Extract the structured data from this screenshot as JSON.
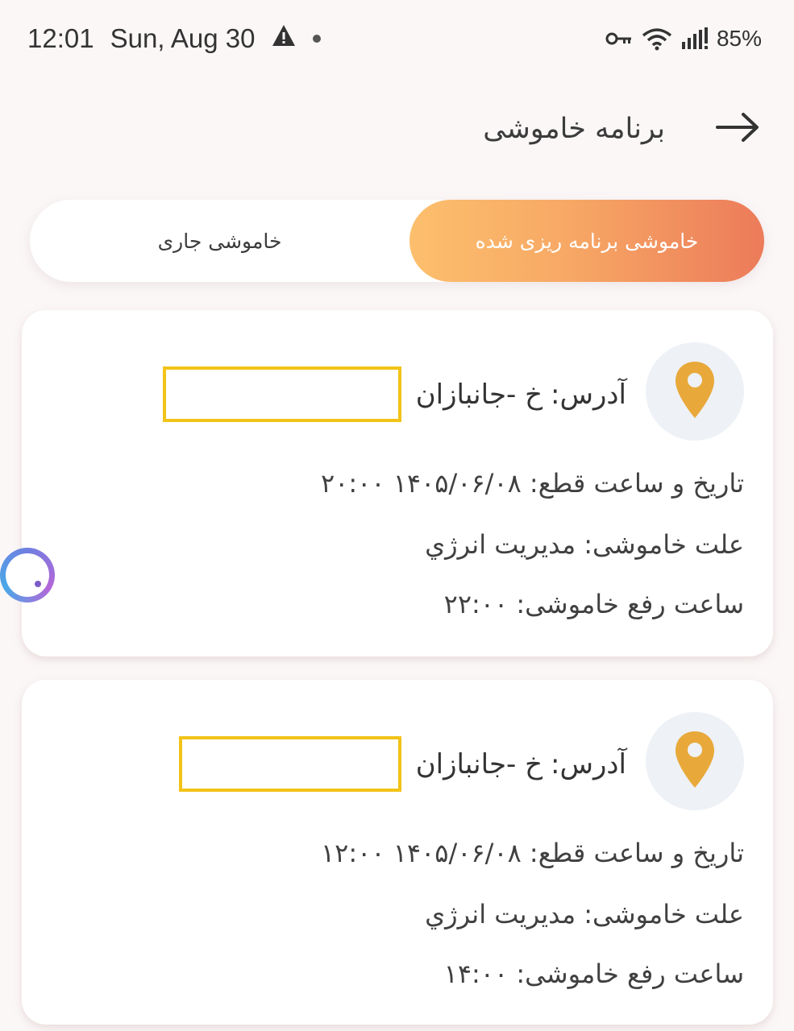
{
  "status_bar": {
    "time": "12:01",
    "date": "Sun, Aug 30",
    "battery": "85%",
    "icons": [
      "alert-icon",
      "notification-dot-icon",
      "vpn-key-icon",
      "wifi-icon",
      "signal-icon"
    ]
  },
  "header": {
    "title": "برنامه خاموشی",
    "back_icon": "arrow-right-icon"
  },
  "tabs": [
    {
      "label": "خاموشی برنامه ریزی شده",
      "active": true
    },
    {
      "label": "خاموشی جاری",
      "active": false
    }
  ],
  "cards": [
    {
      "address_label": "آدرس:",
      "address_value": "خ -جانبازان",
      "cut_time": "تاریخ و ساعت قطع: ۱۴۰۵/۰۶/۰۸ ۲۰:۰۰",
      "reason": "علت خاموشی: مديريت انرژي",
      "restore_time": "ساعت رفع خاموشی: ۲۲:۰۰"
    },
    {
      "address_label": "آدرس:",
      "address_value": "خ -جانبازان",
      "cut_time": "تاریخ و ساعت قطع: ۱۴۰۵/۰۶/۰۸ ۱۲:۰۰",
      "reason": "علت خاموشی: مديريت انرژي",
      "restore_time": "ساعت رفع خاموشی: ۱۴:۰۰"
    }
  ],
  "colors": {
    "accent_start": "#fcbf6d",
    "accent_end": "#ec7b5a",
    "pin": "#e8a93a",
    "redaction_border": "#f2c318"
  }
}
